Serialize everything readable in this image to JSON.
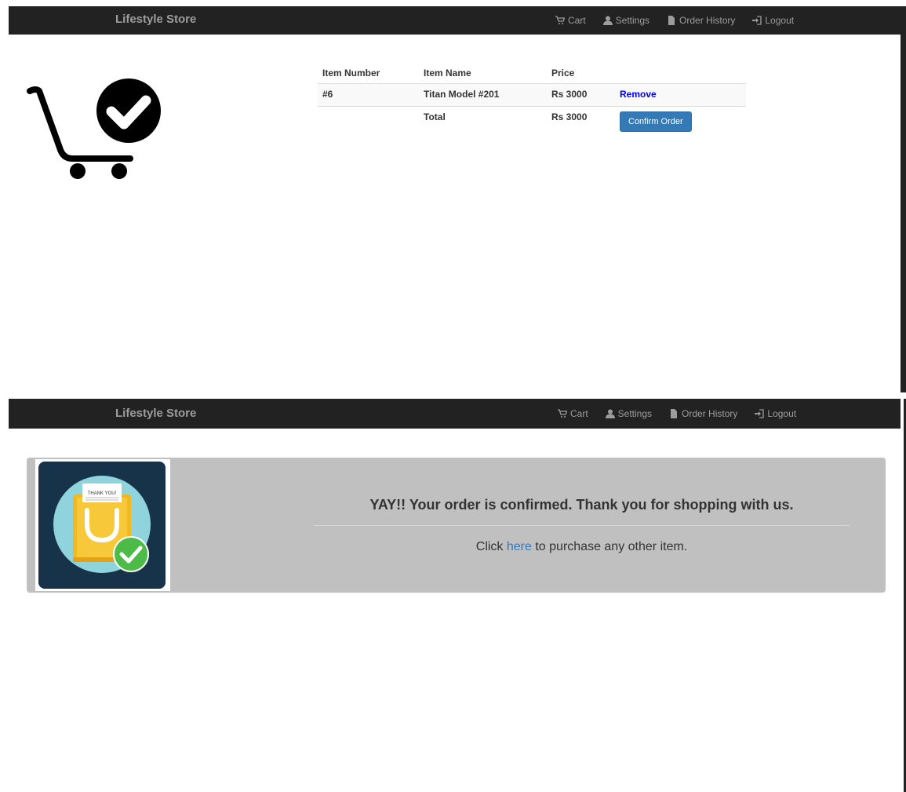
{
  "navbar": {
    "brand": "Lifestyle Store",
    "links": [
      {
        "label": "Cart",
        "icon": "cart-icon"
      },
      {
        "label": "Settings",
        "icon": "user-icon"
      },
      {
        "label": "Order History",
        "icon": "file-icon"
      },
      {
        "label": "Logout",
        "icon": "logout-icon"
      }
    ]
  },
  "cart": {
    "headers": [
      "Item Number",
      "Item Name",
      "Price"
    ],
    "rows": [
      {
        "number": "#6",
        "name": "Titan Model #201",
        "price": "Rs 3000",
        "action": "Remove"
      }
    ],
    "total_label": "Total",
    "total_price": "Rs 3000",
    "confirm_label": "Confirm Order"
  },
  "confirmation": {
    "badge_text": "THANK YOU!",
    "heading": "YAY!! Your order is confirmed. Thank you for shopping with us.",
    "sub_before": "Click ",
    "link_text": "here",
    "sub_after": " to purchase any other item."
  },
  "colors": {
    "navbar_bg": "#222222",
    "nav_text": "#9d9d9d",
    "primary_button": "#337ab7",
    "link_blue": "#0000ee",
    "jumbotron_bg": "#c0c0c0",
    "check_green": "#4cbb47"
  }
}
